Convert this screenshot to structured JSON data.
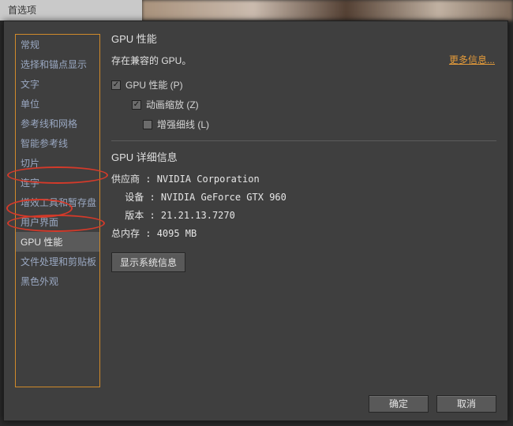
{
  "window": {
    "title": "首选项"
  },
  "sidebar": {
    "items": [
      {
        "label": "常规"
      },
      {
        "label": "选择和锚点显示"
      },
      {
        "label": "文字"
      },
      {
        "label": "单位"
      },
      {
        "label": "参考线和网格"
      },
      {
        "label": "智能参考线"
      },
      {
        "label": "切片"
      },
      {
        "label": "连字"
      },
      {
        "label": "增效工具和暂存盘"
      },
      {
        "label": "用户界面"
      },
      {
        "label": "GPU 性能"
      },
      {
        "label": "文件处理和剪贴板"
      },
      {
        "label": "黑色外观"
      }
    ],
    "selected_index": 10
  },
  "main": {
    "section_title": "GPU 性能",
    "compat_msg": "存在兼容的 GPU。",
    "more_info": "更多信息...",
    "checks": {
      "gpu_perf": {
        "label": "GPU 性能 (P)",
        "checked": true
      },
      "anim_zoom": {
        "label": "动画缩放 (Z)",
        "checked": true
      },
      "enhance_thin": {
        "label": "增强细线 (L)",
        "checked": false
      }
    },
    "details": {
      "title": "GPU 详细信息",
      "vendor_label": "供应商 :",
      "vendor_value": "NVIDIA Corporation",
      "device_label": "设备 :",
      "device_value": "NVIDIA GeForce GTX 960",
      "version_label": "版本 :",
      "version_value": "21.21.13.7270",
      "memory_label": "总内存 :",
      "memory_value": "4095 MB",
      "sysinfo_btn": "显示系统信息"
    }
  },
  "footer": {
    "ok": "确定",
    "cancel": "取消"
  }
}
